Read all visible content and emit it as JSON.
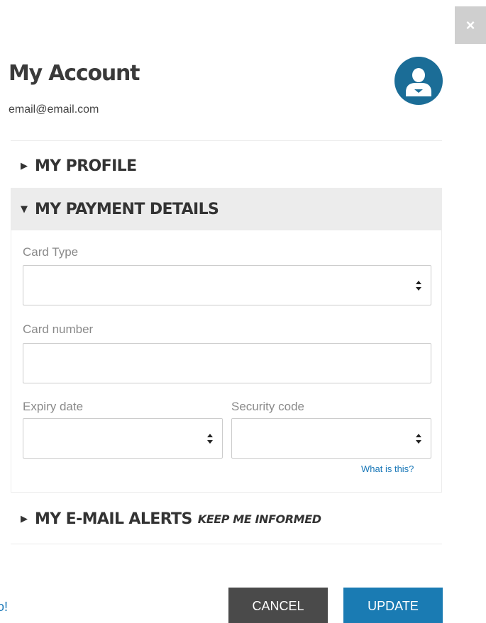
{
  "header": {
    "title": "My Account",
    "email": "email@email.com",
    "close_glyph": "×"
  },
  "sections": {
    "profile": {
      "label": "MY PROFILE",
      "expanded": false
    },
    "payment": {
      "label": "MY PAYMENT DETAILS",
      "expanded": true
    },
    "alerts": {
      "label": "MY E-MAIL ALERTS",
      "sublabel": "KEEP ME INFORMED",
      "expanded": false
    }
  },
  "payment_form": {
    "card_type_label": "Card Type",
    "card_type_value": "",
    "card_number_label": "Card number",
    "card_number_value": "",
    "expiry_label": "Expiry date",
    "expiry_value": "",
    "security_label": "Security code",
    "security_value": "",
    "what_is_this": "What is this?"
  },
  "footer": {
    "cancel_label": "CANCEL",
    "update_label": "UPDATE",
    "partial_link": "o!"
  },
  "colors": {
    "accent_blue": "#1a7bb3",
    "avatar_blue": "#1b6d97",
    "cancel_gray": "#4a4a4a",
    "section_bg": "#ececec"
  },
  "icons": {
    "close": "close-icon",
    "avatar": "user-avatar-icon",
    "caret_collapsed": "caret-right-icon",
    "caret_expanded": "caret-down-icon",
    "select": "select-arrows-icon"
  }
}
